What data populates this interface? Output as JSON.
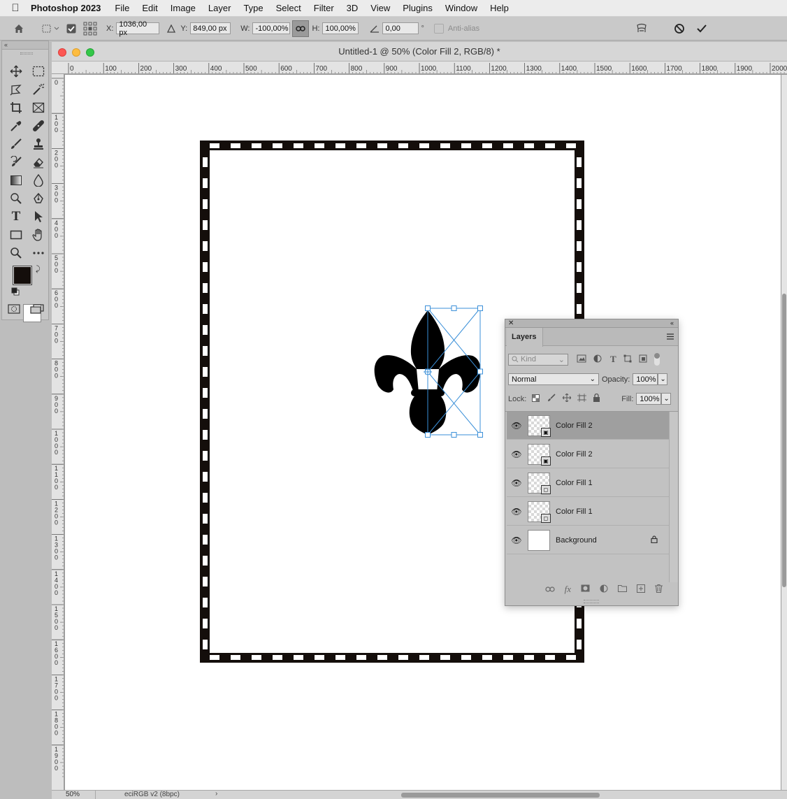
{
  "menubar": {
    "app_name": "Photoshop 2023",
    "items": [
      "File",
      "Edit",
      "Image",
      "Layer",
      "Type",
      "Select",
      "Filter",
      "3D",
      "View",
      "Plugins",
      "Window",
      "Help"
    ]
  },
  "options": {
    "x_label": "X:",
    "x_value": "1036,00 px",
    "y_label": "Y:",
    "y_value": "849,00 px",
    "w_label": "W:",
    "w_value": "-100,00%",
    "h_label": "H:",
    "h_value": "100,00%",
    "angle_value": "0,00",
    "degree": "°",
    "antialias_label": "Anti-alias"
  },
  "document": {
    "title": "Untitled-1 @ 50% (Color Fill 2, RGB/8) *",
    "ruler_h_labels": [
      "0",
      "100",
      "200",
      "300",
      "400",
      "500",
      "600",
      "700",
      "800",
      "900",
      "1000",
      "1100",
      "1200",
      "1300",
      "1400",
      "1500",
      "1600",
      "1700",
      "1800",
      "1900",
      "2000"
    ],
    "ruler_v_labels": [
      "0",
      "1\n0\n0",
      "2\n0\n0",
      "3\n0\n0",
      "4\n0\n0",
      "5\n0\n0",
      "6\n0\n0",
      "7\n0\n0",
      "8\n0\n0",
      "9\n0\n0",
      "1\n0\n0\n0",
      "1\n1\n0\n0",
      "1\n2\n0\n0",
      "1\n3\n0\n0",
      "1\n4\n0\n0",
      "1\n5\n0\n0",
      "1\n6\n0\n0",
      "1\n7\n0\n0",
      "1\n8\n0\n0",
      "1\n9\n0\n0"
    ],
    "zoom": "50%",
    "color_profile": "eciRGB v2 (8bpc)"
  },
  "colors": {
    "foreground": "#140e0b",
    "background": "#ffffff",
    "selection": "#3a8fd8"
  },
  "layers_panel": {
    "tab": "Layers",
    "filter_placeholder": "Kind",
    "blend_mode": "Normal",
    "opacity_label": "Opacity:",
    "opacity_value": "100%",
    "lock_label": "Lock:",
    "fill_label": "Fill:",
    "fill_value": "100%",
    "layers": [
      {
        "name": "Color Fill 2",
        "selected": true,
        "type": "shape"
      },
      {
        "name": "Color Fill 2",
        "selected": false,
        "type": "shape"
      },
      {
        "name": "Color Fill 1",
        "selected": false,
        "type": "shape"
      },
      {
        "name": "Color Fill 1",
        "selected": false,
        "type": "shape"
      },
      {
        "name": "Background",
        "selected": false,
        "type": "background",
        "locked": true
      }
    ]
  }
}
